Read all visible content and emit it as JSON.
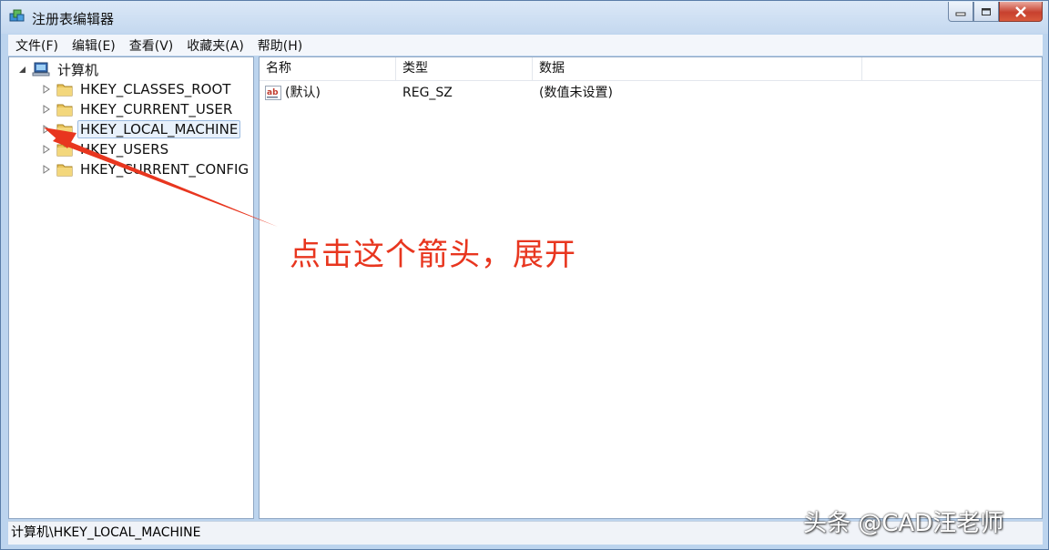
{
  "window": {
    "title": "注册表编辑器",
    "controls": {
      "minimize": "minimize",
      "maximize": "maximize",
      "close": "close"
    }
  },
  "menu": [
    "文件(F)",
    "编辑(E)",
    "查看(V)",
    "收藏夹(A)",
    "帮助(H)"
  ],
  "tree": {
    "root": "计算机",
    "items": [
      "HKEY_CLASSES_ROOT",
      "HKEY_CURRENT_USER",
      "HKEY_LOCAL_MACHINE",
      "HKEY_USERS",
      "HKEY_CURRENT_CONFIG"
    ],
    "selected": "HKEY_LOCAL_MACHINE"
  },
  "list": {
    "columns": [
      "名称",
      "类型",
      "数据"
    ],
    "rows": [
      {
        "name": "(默认)",
        "type": "REG_SZ",
        "data": "(数值未设置)",
        "icon": "string-value-icon"
      }
    ]
  },
  "status": {
    "path": "计算机\\HKEY_LOCAL_MACHINE"
  },
  "annotation": {
    "text": "点击这个箭头，展开",
    "color": "#e8361f"
  },
  "watermark": {
    "text": "头条 @CAD汪老师"
  },
  "colors": {
    "frame": "#bcd4ee",
    "selection": "#e8f1fb",
    "annotation": "#e8361f"
  }
}
